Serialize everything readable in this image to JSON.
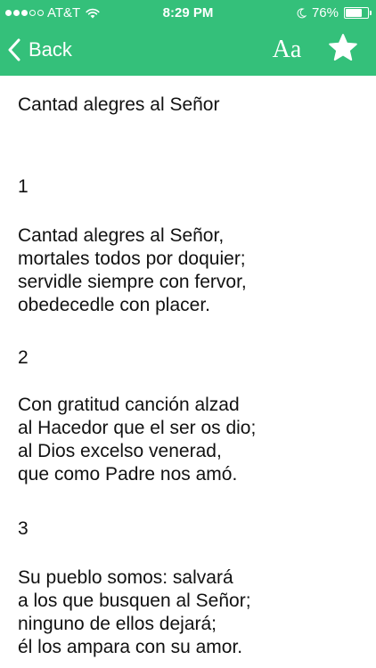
{
  "status_bar": {
    "carrier": "AT&T",
    "time": "8:29 PM",
    "battery_percent": "76%",
    "battery_level": 0.76,
    "signal_filled": 3,
    "signal_total": 5
  },
  "nav": {
    "back_label": "Back",
    "font_label": "Aa"
  },
  "song": {
    "title": "Cantad alegres al Señor",
    "verses": [
      {
        "number": "1",
        "lines": [
          "Cantad alegres al Señor,",
          "mortales todos por doquier;",
          "servidle siempre con fervor,",
          "obedecedle con placer."
        ]
      },
      {
        "number": "2",
        "lines": [
          "Con gratitud canción alzad",
          "al Hacedor que el ser os dio;",
          "al Dios excelso venerad,",
          "que como Padre nos amó."
        ]
      },
      {
        "number": "3",
        "lines": [
          "Su pueblo somos: salvará",
          "a los que busquen al Señor;",
          "ninguno de ellos dejará;",
          "él los ampara con su amor."
        ]
      }
    ]
  },
  "colors": {
    "header": "#34c07a",
    "text": "#111111"
  }
}
